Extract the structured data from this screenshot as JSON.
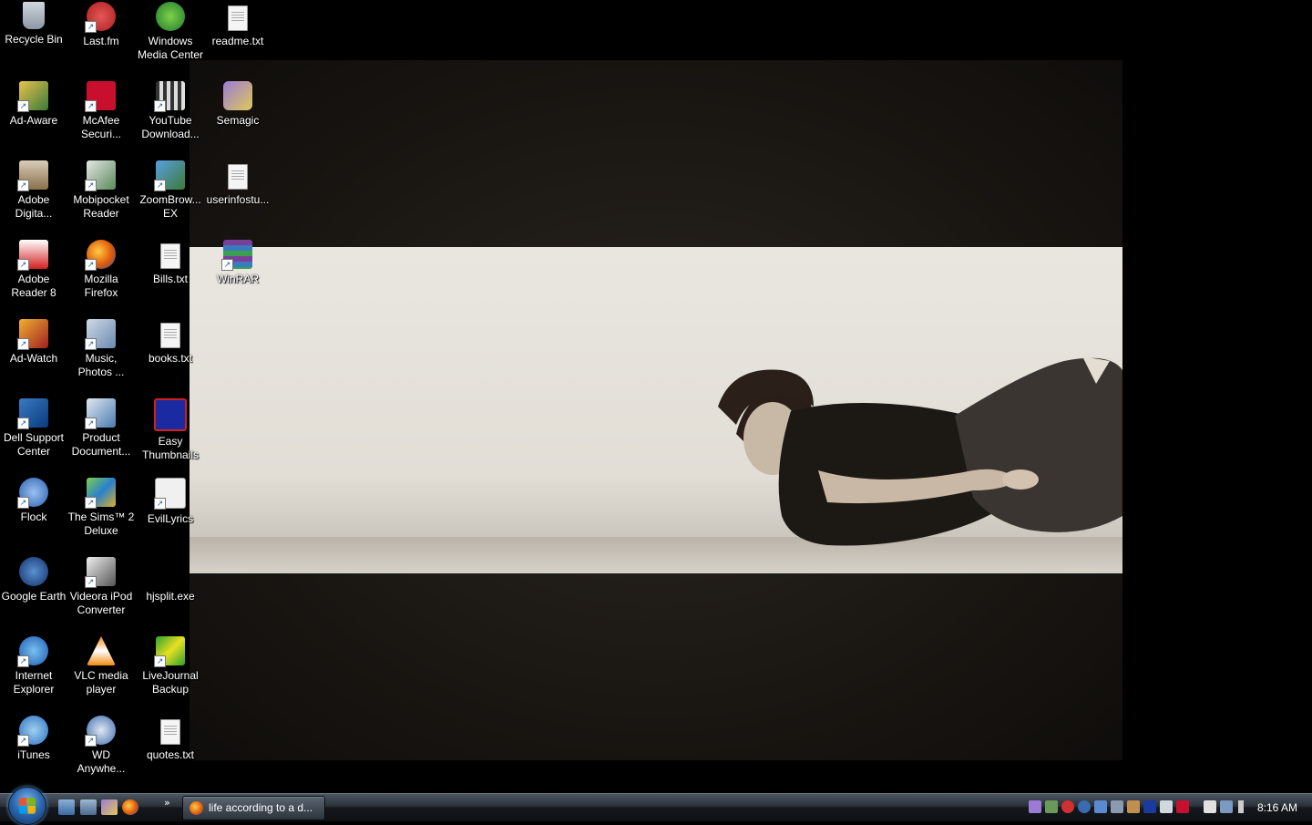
{
  "desktop": {
    "icons": [
      {
        "label": "Recycle Bin"
      },
      {
        "label": "Last.fm"
      },
      {
        "label": "Windows\nMedia Center"
      },
      {
        "label": "readme.txt"
      },
      {
        "label": "Ad-Aware"
      },
      {
        "label": "McAfee\nSecuri..."
      },
      {
        "label": "YouTube\nDownload..."
      },
      {
        "label": "Semagic"
      },
      {
        "label": "Adobe\nDigita..."
      },
      {
        "label": "Mobipocket\nReader"
      },
      {
        "label": "ZoomBrow...\nEX"
      },
      {
        "label": "userinfostu..."
      },
      {
        "label": "Adobe\nReader 8"
      },
      {
        "label": "Mozilla\nFirefox"
      },
      {
        "label": "Bills.txt"
      },
      {
        "label": "WinRAR"
      },
      {
        "label": "Ad-Watch"
      },
      {
        "label": "Music,\nPhotos ..."
      },
      {
        "label": "books.txt"
      },
      {
        "label": "Dell Support\nCenter"
      },
      {
        "label": "Product\nDocument..."
      },
      {
        "label": "Easy\nThumbnails"
      },
      {
        "label": "Flock"
      },
      {
        "label": "The Sims™ 2\nDeluxe"
      },
      {
        "label": "EvilLyrics"
      },
      {
        "label": "Google Earth"
      },
      {
        "label": "Videora iPod\nConverter"
      },
      {
        "label": "hjsplit.exe"
      },
      {
        "label": "Internet\nExplorer"
      },
      {
        "label": "VLC media\nplayer"
      },
      {
        "label": "LiveJournal\nBackup"
      },
      {
        "label": "iTunes"
      },
      {
        "label": "WD\nAnywhe..."
      },
      {
        "label": "quotes.txt"
      }
    ]
  },
  "taskbar": {
    "more_label": "»",
    "task_button_label": "life according to a d...",
    "clock": "8:16 AM"
  }
}
